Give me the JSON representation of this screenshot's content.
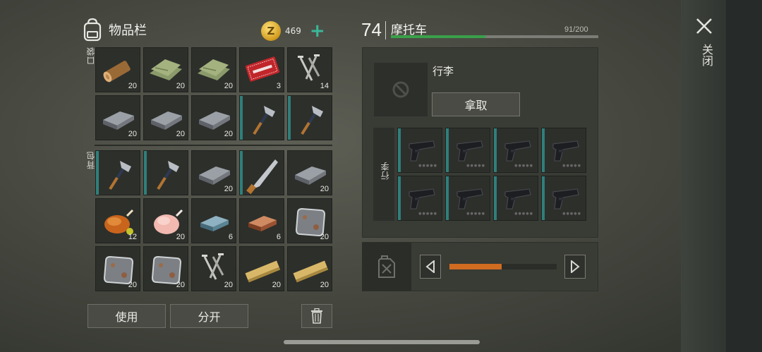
{
  "inventory": {
    "title": "物品栏",
    "coins": "469",
    "coin_symbol": "Z",
    "plus": "+",
    "pocket_label": "口袋",
    "backpack_label": "背包",
    "pocket": [
      {
        "icon": "log-icon",
        "qty": "20"
      },
      {
        "icon": "cloth-icon",
        "qty": "20"
      },
      {
        "icon": "cloth-icon",
        "qty": "20"
      },
      {
        "icon": "coupon-icon",
        "qty": "3"
      },
      {
        "icon": "nails-icon",
        "qty": "14"
      },
      {
        "icon": "iron-ingot-icon",
        "qty": "20"
      },
      {
        "icon": "iron-ingot-icon",
        "qty": "20"
      },
      {
        "icon": "iron-ingot-icon",
        "qty": "20"
      },
      {
        "icon": "hatchet-icon",
        "qty": ""
      },
      {
        "icon": "hatchet-icon",
        "qty": ""
      }
    ],
    "backpack": [
      {
        "icon": "hatchet-icon",
        "qty": ""
      },
      {
        "icon": "hatchet-icon",
        "qty": ""
      },
      {
        "icon": "iron-ingot-icon",
        "qty": "20"
      },
      {
        "icon": "machete-icon",
        "qty": ""
      },
      {
        "icon": "iron-ingot-icon",
        "qty": "20"
      },
      {
        "icon": "roast-chicken-icon",
        "qty": "12"
      },
      {
        "icon": "raw-chicken-icon",
        "qty": "20"
      },
      {
        "icon": "steel-bar-icon",
        "qty": "6"
      },
      {
        "icon": "copper-bar-icon",
        "qty": "6"
      },
      {
        "icon": "metal-plate-icon",
        "qty": "20"
      },
      {
        "icon": "metal-plate-icon",
        "qty": "20"
      },
      {
        "icon": "metal-plate-icon",
        "qty": "20"
      },
      {
        "icon": "nails-icon",
        "qty": "20"
      },
      {
        "icon": "plank-icon",
        "qty": "20"
      },
      {
        "icon": "plank-icon",
        "qty": "20"
      }
    ],
    "use_label": "使用",
    "split_label": "分开"
  },
  "vehicle": {
    "level": "74",
    "name": "摩托车",
    "capacity": "91/200",
    "capacity_fraction": 0.455,
    "bag_name": "行李",
    "take_label": "拿取",
    "bag_side_label": "行李",
    "slots": [
      "pistol-icon",
      "pistol-icon",
      "pistol-icon",
      "pistol-icon",
      "pistol-icon",
      "pistol-icon",
      "pistol-icon",
      "pistol-icon"
    ],
    "fuel_fraction": 0.49
  },
  "close_label": "关闭",
  "colors": {
    "accent_teal": "#3bb89b",
    "capacity_green": "#3aa04a",
    "fuel_orange": "#d06b20"
  }
}
